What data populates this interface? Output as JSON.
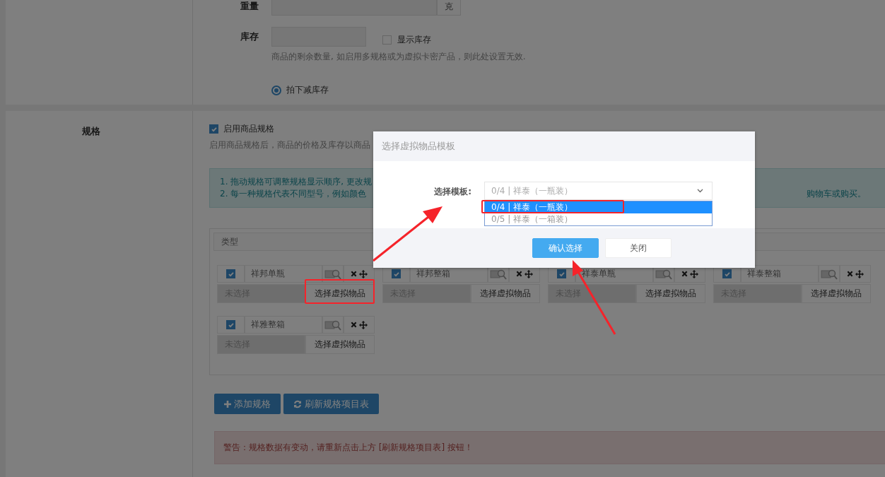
{
  "weight": {
    "label": "重量",
    "unit": "克"
  },
  "stock": {
    "label": "库存",
    "show_stock": {
      "label": "显示库存",
      "checked": false
    },
    "help": "商品的剩余数量, 如启用多规格或为虚拟卡密产品，则此处设置无效."
  },
  "stock_mode": {
    "label": "拍下减库存",
    "selected": true
  },
  "spec": {
    "label": "规格",
    "enable": {
      "label": "启用商品规格",
      "checked": true
    },
    "help": "启用商品规格后，商品的价格及库存以商品",
    "tips": [
      {
        "text": "1. 拖动规格可调整规格显示顺序, 更改规"
      },
      {
        "text": "2. 每一种规格代表不同型号，例如颜色",
        "tail": "购物车或购买。"
      }
    ],
    "group_title": "类型",
    "items": [
      {
        "checked": true,
        "name": "祥邦单瓶",
        "status": "未选择",
        "action": "选择虚拟物品"
      },
      {
        "checked": true,
        "name": "祥邦整箱",
        "status": "未选择",
        "action": "选择虚拟物品"
      },
      {
        "checked": true,
        "name": "祥泰单瓶",
        "status": "未选择",
        "action": "选择虚拟物品"
      },
      {
        "checked": true,
        "name": "祥泰整箱",
        "status": "未选择",
        "action": "选择虚拟物品"
      },
      {
        "checked": true,
        "name": "祥雅整箱",
        "status": "未选择",
        "action": "选择虚拟物品"
      }
    ],
    "buttons": [
      {
        "kind": "add",
        "label": "添加规格"
      },
      {
        "kind": "refresh",
        "label": "刷新规格项目表"
      }
    ],
    "warning": "警告：规格数据有变动，请重新点击上方 [刷新规格项目表] 按钮！"
  },
  "dialog": {
    "title": "选择虚拟物品模板",
    "field_label": "选择模板:",
    "value": "0/4 | 祥泰（一瓶装）",
    "options": [
      {
        "label": "0/4 | 祥泰（一瓶装）",
        "selected": true
      },
      {
        "label": "0/5 | 祥泰（一箱装）",
        "selected": false
      }
    ],
    "buttons": [
      {
        "kind": "primary",
        "label": "确认选择"
      },
      {
        "kind": "default",
        "label": "关闭"
      }
    ]
  }
}
